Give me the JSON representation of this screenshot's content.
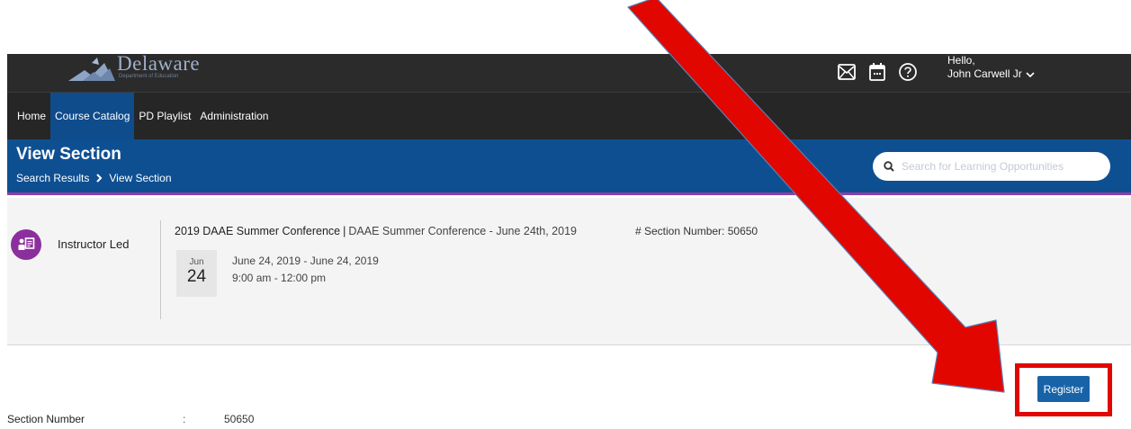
{
  "header": {
    "logo_text": "Delaware",
    "logo_subtext": "Department of Education",
    "greeting": "Hello,",
    "user_name": "John Carwell Jr"
  },
  "icons": {
    "messages": "mail-icon",
    "calendar": "calendar-icon",
    "help": "help-icon",
    "user_menu": "chevron-down-icon",
    "search": "search-icon",
    "instructor_led": "instructor-led-icon"
  },
  "nav": {
    "items": [
      {
        "label": "Home"
      },
      {
        "label": "Course Catalog",
        "active": true
      },
      {
        "label": "PD Playlist"
      },
      {
        "label": "Administration"
      }
    ]
  },
  "banner": {
    "title": "View Section",
    "breadcrumbs": [
      "Search Results",
      "View Section"
    ],
    "search_placeholder": "Search for Learning Opportunities"
  },
  "section": {
    "type_label": "Instructor Led",
    "course_title": "2019 DAAE Summer Conference",
    "section_title": "DAAE Summer Conference - June 24th, 2019",
    "section_number_label": "# Section Number: 50650",
    "date_month": "Jun",
    "date_day": "24",
    "date_range": "June 24, 2019 - June 24, 2019",
    "time_range": "9:00 am - 12:00 pm"
  },
  "actions": {
    "register_label": "Register"
  },
  "details": {
    "section_number_label": "Section Number",
    "section_number_value": "50650"
  },
  "colors": {
    "header_bg": "#2b2b2b",
    "nav_active": "#0f4c8c",
    "banner_bg": "#0e4f92",
    "banner_border": "#8d3fa6",
    "badge": "#8b2f9d",
    "register_btn": "#1863a8",
    "annotation": "#e10600"
  }
}
